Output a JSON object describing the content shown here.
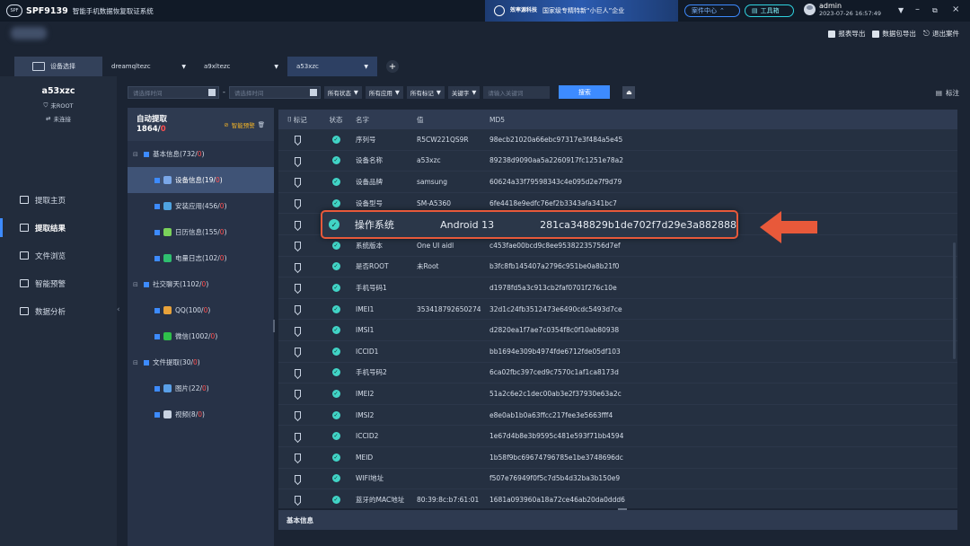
{
  "titlebar": {
    "app_code": "SPF9139",
    "app_title": "智能手机数据恢复取证系统",
    "banner_brand": "效率源科技",
    "banner_text": "国家级专精特新“小巨人”企业",
    "case_center": "案件中心",
    "toolbox": "工具箱",
    "user_name": "admin",
    "user_time": "2023-07-26 16:57:49"
  },
  "top_actions": [
    {
      "label": "报表导出",
      "icon": "report-export-icon"
    },
    {
      "label": "数据包导出",
      "icon": "package-export-icon"
    },
    {
      "label": "退出案件",
      "icon": "exit-case-icon"
    }
  ],
  "device_tabs": {
    "select_label": "设备选择",
    "devices": [
      "dreamqltezc",
      "a9xltezc",
      "a53xzc"
    ],
    "active_index": 2
  },
  "left_panel": {
    "device_name": "a53xzc",
    "root_status": "未ROOT",
    "connect_status": "未连接",
    "nav": [
      {
        "label": "提取主页",
        "icon": "home-icon"
      },
      {
        "label": "提取结果",
        "icon": "result-icon"
      },
      {
        "label": "文件浏览",
        "icon": "folder-icon"
      },
      {
        "label": "智能预警",
        "icon": "alert-icon"
      },
      {
        "label": "数据分析",
        "icon": "analysis-icon"
      }
    ],
    "active_nav": 1
  },
  "filters": {
    "start_placeholder": "请选择时间",
    "end_placeholder": "请选择时间",
    "status": "所有状态",
    "apps": "所有应用",
    "marks": "所有标记",
    "keyword": "关键字",
    "keyword_placeholder": "请输入关键词",
    "search": "搜索",
    "mark_button": "标注"
  },
  "tree": {
    "title": "自动提取",
    "count_total": "1864/",
    "count_red": "0",
    "warn_label": "智能预警",
    "items": [
      {
        "label": "基本信息(732/",
        "red": "0",
        "tail": ")",
        "level": 0
      },
      {
        "label": "设备信息(19/",
        "red": "0",
        "tail": ")",
        "level": 1,
        "selected": true,
        "icon_color": "#7aa7e8"
      },
      {
        "label": "安装应用(456/",
        "red": "0",
        "tail": ")",
        "level": 1,
        "icon_color": "#4fa3e0"
      },
      {
        "label": "日历信息(155/",
        "red": "0",
        "tail": ")",
        "level": 1,
        "icon_color": "#7ad15a"
      },
      {
        "label": "电量日志(102/",
        "red": "0",
        "tail": ")",
        "level": 1,
        "icon_color": "#2fbf6f"
      },
      {
        "label": "社交聊天(1102/",
        "red": "0",
        "tail": ")",
        "level": 0
      },
      {
        "label": "QQ(100/",
        "red": "0",
        "tail": ")",
        "level": 1,
        "icon_color": "#e8a23a"
      },
      {
        "label": "微信(1002/",
        "red": "0",
        "tail": ")",
        "level": 1,
        "icon_color": "#2fbf4a"
      },
      {
        "label": "文件提取(30/",
        "red": "0",
        "tail": ")",
        "level": 0
      },
      {
        "label": "图片(22/",
        "red": "0",
        "tail": ")",
        "level": 1,
        "icon_color": "#5aa0e8"
      },
      {
        "label": "视频(8/",
        "red": "0",
        "tail": ")",
        "level": 1,
        "icon_color": "#c9d3e2"
      }
    ]
  },
  "table": {
    "headers": [
      "标记",
      "状态",
      "名字",
      "值",
      "MD5"
    ],
    "rows": [
      {
        "name": "序列号",
        "value": "R5CW221QS9R",
        "md5": "98ecb21020a66ebc97317e3f484a5e45"
      },
      {
        "name": "设备名称",
        "value": "a53xzc",
        "md5": "89238d9090aa5a2260917fc1251e78a2"
      },
      {
        "name": "设备品牌",
        "value": "samsung",
        "md5": "60624a33f79598343c4e095d2e7f9d79"
      },
      {
        "name": "设备型号",
        "value": "SM-A5360",
        "md5": "6fe4418e9edfc76ef2b3343afa341bc7"
      },
      {
        "name": "操作系统",
        "value": "Android 13",
        "md5": "281ca348829b1de702f7d29e3a882888"
      },
      {
        "name": "系统版本",
        "value": "One UI aidl",
        "md5": "c453fae00bcd9c8ee95382235756d7ef"
      },
      {
        "name": "是否ROOT",
        "value": "未Root",
        "md5": "b3fc8fb145407a2796c951be0a8b21f0"
      },
      {
        "name": "手机号码1",
        "value": "",
        "md5": "d1978fd5a3c913cb2faf0701f276c10e"
      },
      {
        "name": "IMEI1",
        "value": "353418792650274",
        "md5": "32d1c24fb3512473e6490cdc5493d7ce"
      },
      {
        "name": "IMSI1",
        "value": "",
        "md5": "d2820ea1f7ae7c0354f8c0f10ab80938"
      },
      {
        "name": "ICCID1",
        "value": "",
        "md5": "bb1694e309b4974fde6712fde05df103"
      },
      {
        "name": "手机号码2",
        "value": "",
        "md5": "6ca02fbc397ced9c7570c1af1ca8173d"
      },
      {
        "name": "IMEI2",
        "value": "",
        "md5": "51a2c6e2c1dec00ab3e2f37930e63a2c"
      },
      {
        "name": "IMSI2",
        "value": "",
        "md5": "e8e0ab1b0a63ffcc217fee3e5663fff4"
      },
      {
        "name": "ICCID2",
        "value": "",
        "md5": "1e67d4b8e3b9595c481e593f71bb4594"
      },
      {
        "name": "MEID",
        "value": "",
        "md5": "1b58f9bc69674796785e1be3748696dc"
      },
      {
        "name": "WIFI地址",
        "value": "",
        "md5": "f507e76949f0f5c7d5b4d32ba3b150e9"
      },
      {
        "name": "蓝牙的MAC地址",
        "value": "80:39:8c:b7:61:01",
        "md5": "1681a093960a18a72ce46ab20da0ddd6"
      }
    ],
    "highlight": {
      "name": "操作系统",
      "value": "Android 13",
      "md5": "281ca348829b1de702f7d29e3a882888"
    }
  },
  "bottom": {
    "label": "基本信息"
  },
  "colors": {
    "accent": "#3d8bff",
    "highlight_border": "#e8593a",
    "ok": "#41d4c6",
    "danger": "#ff4f4f"
  }
}
